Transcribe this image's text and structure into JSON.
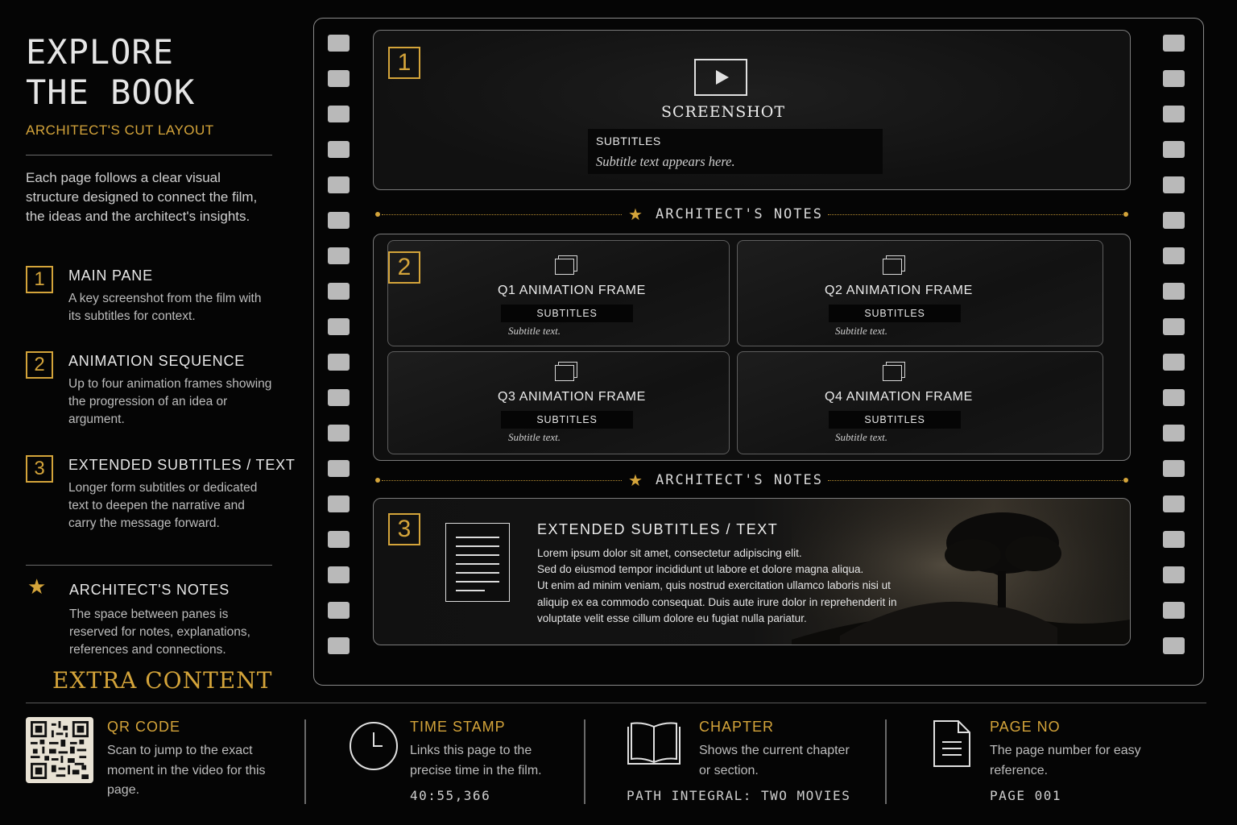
{
  "left": {
    "title_line1": "EXPLORE",
    "title_line2": "THE BOOK",
    "subtitle": "ARCHITECT'S CUT LAYOUT",
    "intro": "Each page follows a clear visual structure designed to connect the film, the ideas and the architect's insights.",
    "legend": [
      {
        "num": "1",
        "head": "MAIN PANE",
        "body": "A key screenshot from the film with its subtitles for context."
      },
      {
        "num": "2",
        "head": "ANIMATION SEQUENCE",
        "body": "Up to four animation frames showing the progression of an idea or argument."
      },
      {
        "num": "3",
        "head": "EXTENDED SUBTITLES / TEXT",
        "body": "Longer form subtitles or dedicated text to deepen the narrative and carry the message forward."
      },
      {
        "num": "",
        "head": "ARCHITECT'S NOTES",
        "body": "The space between panes is reserved for notes, explanations, references and connections."
      }
    ],
    "extra_content": "EXTRA CONTENT"
  },
  "film": {
    "pane1": {
      "num": "1",
      "icon": "screen-play-icon",
      "label": "SCREENSHOT",
      "subtitles_label": "SUBTITLES",
      "subtitle_text": "Subtitle text appears here."
    },
    "notes_label": "ARCHITECT'S NOTES",
    "pane2": {
      "num": "2",
      "frames": [
        {
          "title": "Q1 ANIMATION FRAME",
          "subtitles_label": "SUBTITLES",
          "subtitle_text": "Subtitle text."
        },
        {
          "title": "Q2 ANIMATION FRAME",
          "subtitles_label": "SUBTITLES",
          "subtitle_text": "Subtitle text."
        },
        {
          "title": "Q3 ANIMATION FRAME",
          "subtitles_label": "SUBTITLES",
          "subtitle_text": "Subtitle text."
        },
        {
          "title": "Q4 ANIMATION FRAME",
          "subtitles_label": "SUBTITLES",
          "subtitle_text": "Subtitle text."
        }
      ]
    },
    "pane3": {
      "num": "3",
      "title": "EXTENDED SUBTITLES / TEXT",
      "lines": [
        "Lorem ipsum dolor sit amet, consectetur adipiscing elit.",
        "Sed do eiusmod tempor incididunt ut labore et dolore magna aliqua.",
        "Ut enim ad minim veniam, quis nostrud exercitation ullamco laboris nisi ut",
        "aliquip ex ea commodo consequat. Duis aute irure dolor in reprehenderit in",
        "voluptate velit esse cillum dolore eu fugiat nulla pariatur."
      ]
    }
  },
  "footer": {
    "qr": {
      "head": "QR CODE",
      "body": "Scan to jump to the exact moment in the video for this page."
    },
    "time": {
      "head": "TIME STAMP",
      "body": "Links this page to the precise time in the film.",
      "value": "40:55,366"
    },
    "chapter": {
      "head": "CHAPTER",
      "body": "Shows the current chapter or section.",
      "value": "PATH INTEGRAL: TWO MOVIES"
    },
    "page": {
      "head": "PAGE NO",
      "body": "The page number for easy reference.",
      "value": "PAGE 001"
    }
  },
  "colors": {
    "accent": "#d4a43a",
    "background": "#050505",
    "text": "#d8d8d8"
  }
}
